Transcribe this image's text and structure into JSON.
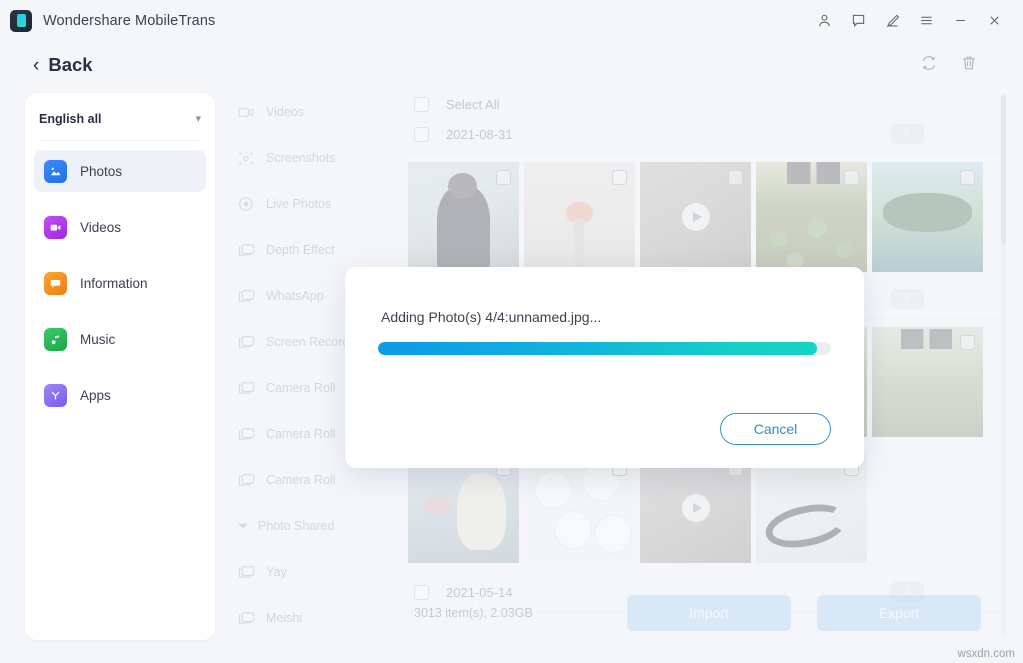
{
  "window": {
    "app_title": "Wondershare MobileTrans",
    "logo_icon": "mobiletrans-logo-icon",
    "controls": [
      {
        "name": "account-icon",
        "label": "Account"
      },
      {
        "name": "feedback-icon",
        "label": "Feedback"
      },
      {
        "name": "edit-pen-icon",
        "label": "Edit"
      },
      {
        "name": "menu-icon",
        "label": "Menu"
      },
      {
        "name": "minimize-icon",
        "label": "Minimize"
      },
      {
        "name": "close-icon",
        "label": "Close"
      }
    ]
  },
  "header": {
    "back_label": "Back",
    "back_icon": "chevron-left-icon",
    "tools": [
      {
        "name": "refresh-icon",
        "label": "Refresh"
      },
      {
        "name": "trash-icon",
        "label": "Delete"
      }
    ]
  },
  "sidebar": {
    "language_select": {
      "value": "English all",
      "caret_icon": "chevron-down-icon"
    },
    "items": [
      {
        "label": "Photos",
        "icon": "photos-icon",
        "color": "#2d7ff4",
        "active": true
      },
      {
        "label": "Videos",
        "icon": "videos-icon",
        "color": "#b83df0",
        "active": false
      },
      {
        "label": "Information",
        "icon": "information-icon",
        "color": "#f59220",
        "active": false
      },
      {
        "label": "Music",
        "icon": "music-icon",
        "color": "#27b355",
        "active": false
      },
      {
        "label": "Apps",
        "icon": "apps-icon",
        "color": "#8a6cf0",
        "active": false
      }
    ]
  },
  "albums": [
    {
      "label": "Videos",
      "icon": "video-camera-icon",
      "type": "item"
    },
    {
      "label": "Screenshots",
      "icon": "screenshot-icon",
      "type": "item"
    },
    {
      "label": "Live Photos",
      "icon": "live-photo-icon",
      "type": "item"
    },
    {
      "label": "Depth Effect",
      "icon": "photo-stack-icon",
      "type": "item"
    },
    {
      "label": "WhatsApp",
      "icon": "photo-stack-icon",
      "type": "item"
    },
    {
      "label": "Screen Recorder",
      "icon": "photo-stack-icon",
      "type": "item"
    },
    {
      "label": "Camera Roll",
      "icon": "photo-stack-icon",
      "type": "item"
    },
    {
      "label": "Camera Roll",
      "icon": "photo-stack-icon",
      "type": "item"
    },
    {
      "label": "Camera Roll",
      "icon": "photo-stack-icon",
      "type": "item"
    },
    {
      "label": "Photo Shared",
      "icon": "caret-down-icon",
      "type": "group"
    },
    {
      "label": "Yay",
      "icon": "photo-stack-icon",
      "type": "item"
    },
    {
      "label": "Meishi",
      "icon": "photo-stack-icon",
      "type": "item"
    }
  ],
  "content": {
    "select_all_label": "Select All",
    "groups": [
      {
        "date": "2021-08-31",
        "count": "5"
      },
      {
        "date": "",
        "count": "9"
      },
      {
        "date": "2021-05-14",
        "count": "3"
      }
    ]
  },
  "bottom": {
    "summary": "3013 item(s), 2.03GB",
    "import_label": "Import",
    "export_label": "Export"
  },
  "modal": {
    "message": "Adding Photo(s) 4/4:unnamed.jpg...",
    "progress_percent": 97,
    "cancel_label": "Cancel",
    "progress_start_color": "#0c9ae8",
    "progress_end_color": "#14d4c4",
    "accent_color": "#2f8ec7"
  },
  "watermark": {
    "text": "wsxdn.com"
  }
}
